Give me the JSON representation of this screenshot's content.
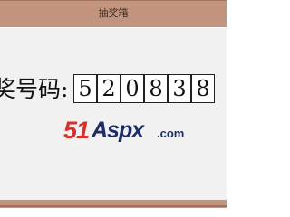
{
  "window": {
    "title": "抽奖箱"
  },
  "prize": {
    "label": "奖号码:",
    "digits": [
      "5",
      "2",
      "0",
      "8",
      "3",
      "8"
    ]
  },
  "watermark": {
    "number_text": "51",
    "brand_text": "Aspx",
    "domain_text": ".com"
  },
  "colors": {
    "titlebar": "#c2947d",
    "content_background": "#f1f1f1",
    "digit_box_border": "#222222",
    "logo_red": "#d72f2a",
    "logo_navy": "#1d2e67"
  }
}
